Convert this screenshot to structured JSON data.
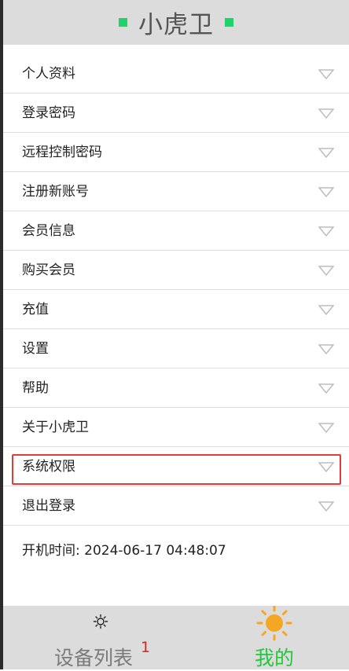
{
  "header": {
    "title": "小虎卫",
    "accent_color": "#1fd36b"
  },
  "menu": {
    "items": [
      {
        "label": "个人资料"
      },
      {
        "label": "登录密码"
      },
      {
        "label": "远程控制密码"
      },
      {
        "label": "注册新账号"
      },
      {
        "label": "会员信息"
      },
      {
        "label": "购买会员"
      },
      {
        "label": "充值"
      },
      {
        "label": "设置"
      },
      {
        "label": "帮助"
      },
      {
        "label": "关于小虎卫"
      },
      {
        "label": "系统权限",
        "highlighted": true
      },
      {
        "label": "退出登录"
      }
    ],
    "highlight_color": "#e23b3b",
    "arrow_icon": "triangle-down-icon"
  },
  "boot_time": {
    "text": "开机时间: 2024-06-17 04:48:07"
  },
  "tabbar": {
    "devices": {
      "label": "设备列表",
      "badge": "1",
      "icon": "gear-icon",
      "color": "#7a7a7a"
    },
    "mine": {
      "label": "我的",
      "icon": "sun-icon",
      "color": "#22c83a",
      "icon_color": "#f5a623"
    },
    "active": "mine"
  }
}
